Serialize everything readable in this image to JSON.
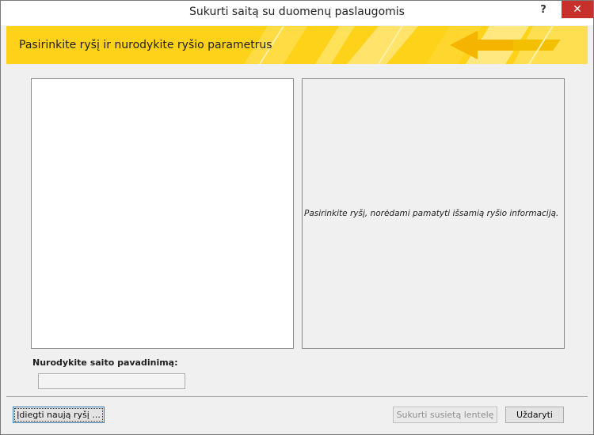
{
  "window": {
    "title": "Sukurti saitą su duomenų paslaugomis",
    "help_label": "?",
    "close_label": "✕"
  },
  "banner": {
    "text": "Pasirinkite ryšį ir nurodykite ryšio parametrus"
  },
  "info_panel": {
    "text": "Pasirinkite ryšį, norėdami pamatyti išsamią ryšio informaciją."
  },
  "link_name": {
    "label": "Nurodykite saito pavadinimą:",
    "value": ""
  },
  "buttons": {
    "install": "Įdiegti naują ryšį ...",
    "create": "Sukurti susietą lentelę",
    "close": "Uždaryti"
  },
  "colors": {
    "banner": "#ffd21a",
    "close_button": "#c7302b"
  }
}
